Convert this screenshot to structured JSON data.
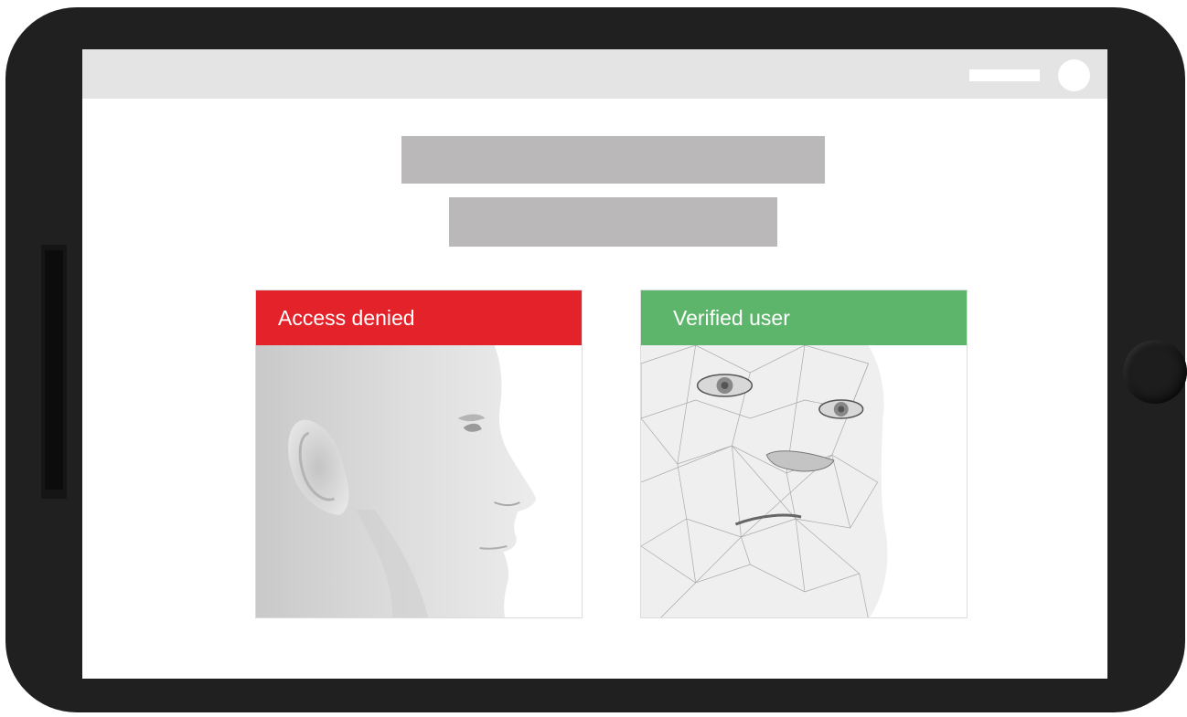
{
  "screen": {
    "cards": [
      {
        "status_label": "Access denied",
        "status_color": "#e42229",
        "image": "face-profile-icon"
      },
      {
        "status_label": "Verified user",
        "status_color": "#5db56b",
        "image": "face-wireframe-icon"
      }
    ]
  }
}
